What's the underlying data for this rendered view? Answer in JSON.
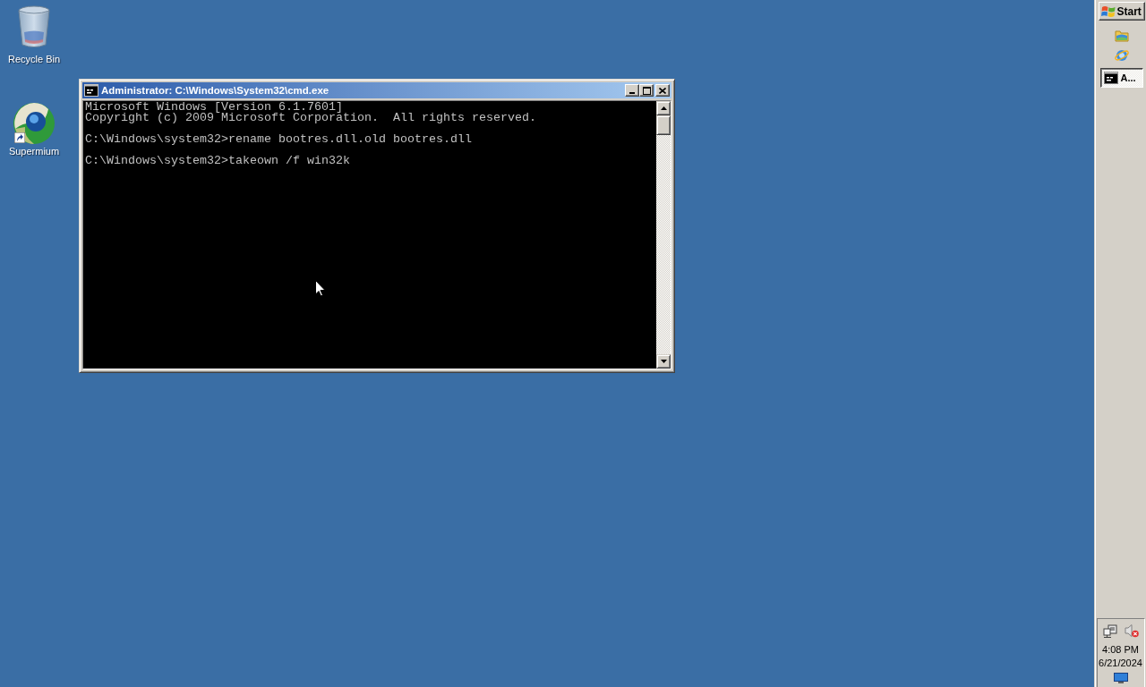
{
  "desktop_icons": [
    {
      "label": "Recycle Bin",
      "kind": "trash"
    },
    {
      "label": "Supermium",
      "kind": "shortcut"
    }
  ],
  "window": {
    "title": "Administrator: C:\\Windows\\System32\\cmd.exe",
    "active": true,
    "console_blocks": [
      [
        "Microsoft Windows [Version 6.1.7601]",
        "Copyright (c) 2009 Microsoft Corporation.  All rights reserved."
      ],
      [
        "C:\\Windows\\system32>rename bootres.dll.old bootres.dll"
      ],
      [
        "C:\\Windows\\system32>takeown /f win32k"
      ]
    ]
  },
  "taskbar": {
    "start_label": "Start",
    "tasks": [
      {
        "label": "A...",
        "selected": true
      }
    ],
    "tray": {
      "volume_muted": true,
      "time": "4:08 PM",
      "date": "6/21/2024"
    }
  }
}
